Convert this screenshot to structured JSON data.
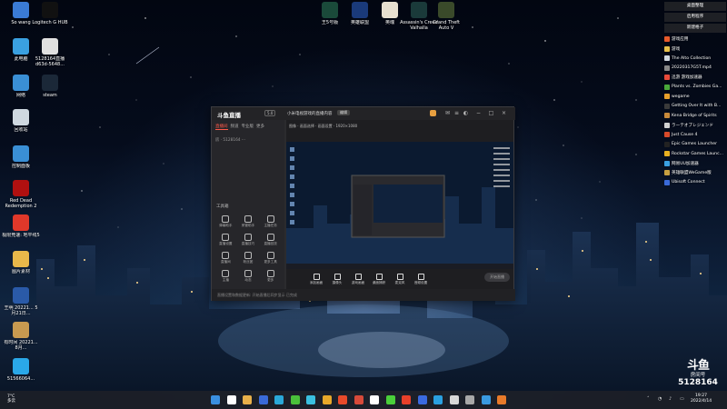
{
  "desktop": {
    "left_icons": [
      {
        "label": "So wang",
        "color": "#3a7bd5"
      },
      {
        "label": "Logitech G HUB",
        "color": "#111111"
      },
      {
        "label": "此电脑",
        "color": "#3aa0e0"
      },
      {
        "label": "5128164直播 d63d-5648...",
        "color": "#e0e0e0"
      },
      {
        "label": "网络",
        "color": "#3a8fd5"
      },
      {
        "label": "steam",
        "color": "#1b2838"
      },
      {
        "label": "回收站",
        "color": "#cfd8e0"
      },
      {
        "label": "控制面板",
        "color": "#3a8fd5"
      },
      {
        "label": "Red Dead Redemption 2",
        "color": "#b01010"
      },
      {
        "label": "极限竞速: 地平线5",
        "color": "#e0382a"
      },
      {
        "label": "图片素材",
        "color": "#e8b84a"
      },
      {
        "label": "王明 20221... 5月21日...",
        "color": "#2a5aa8"
      },
      {
        "label": "有时间 20221... 8月...",
        "color": "#c89a50"
      },
      {
        "label": "51566064...",
        "color": "#2aa8e8"
      }
    ],
    "top_icons": [
      {
        "label": "王5号版",
        "color": "#1a4a3a"
      },
      {
        "label": "英雄联盟",
        "color": "#1a3a7a"
      },
      {
        "label": "英魂",
        "color": "#e8e0d0"
      },
      {
        "label": "Assassin's Creed Valhalla",
        "color": "#1a3a3a"
      },
      {
        "label": "Grand Theft Auto V",
        "color": "#3a4a2a"
      }
    ],
    "right_list": {
      "header1": "桌面整理",
      "header2": "启用程序",
      "header3": "新建格子",
      "items": [
        {
          "label": "游戏应用",
          "color": "#e85a2a"
        },
        {
          "label": "游戏",
          "color": "#e8c04a"
        },
        {
          "label": "The Alto Collection",
          "color": "#d0d8e0"
        },
        {
          "label": "20220317G5T.mp4",
          "color": "#888888"
        },
        {
          "label": "迅游 游戏加速器",
          "color": "#e84a3a"
        },
        {
          "label": "Plants vs. Zombies Ga...",
          "color": "#4aa83a"
        },
        {
          "label": "wegame",
          "color": "#e8a02a"
        },
        {
          "label": "Getting Over It with B...",
          "color": "#3a3a3a"
        },
        {
          "label": "Kena Bridge of Spirits",
          "color": "#c88a3a"
        },
        {
          "label": "ラーテオブレジェンド",
          "color": "#d0d0d0"
        },
        {
          "label": "Just Cause 4",
          "color": "#d84a2a"
        },
        {
          "label": "Epic Games Launcher",
          "color": "#222222"
        },
        {
          "label": "Rockstar Games Launc...",
          "color": "#e8b020"
        },
        {
          "label": "网易UU加速器",
          "color": "#3aa0e0"
        },
        {
          "label": "英雄联盟WeGame版",
          "color": "#c8a040"
        },
        {
          "label": "Ubisoft Connect",
          "color": "#3a6ad8"
        }
      ]
    }
  },
  "app": {
    "logo": "斗鱼直播",
    "version": "5.0",
    "title": "小米电视游戏的直播内容",
    "title_button": "编辑",
    "tabs": [
      "直播间",
      "频道",
      "专业版",
      "更多"
    ],
    "room_line": "房 · 5128164 ···",
    "preview_head": "图像 · 画面选择 · 画面设置 · 1920×1080",
    "tools_title": "工具箱",
    "tools": [
      "弹幕助手",
      "房管助手",
      "主播任务",
      "直播设置",
      "直播技巧",
      "直播回放",
      "直播间",
      "粉丝团",
      "更多工具",
      "主播",
      "动态",
      "更多"
    ],
    "bottom_actions": [
      "添加画面",
      "摄像头",
      "游戏画面",
      "桌面捕获",
      "麦克风",
      "音频设置"
    ],
    "live_button": "开始直播",
    "status": "直播设置和数据更新: 开始直播后同步显示 已完成"
  },
  "taskbar": {
    "weather_temp": "7°C",
    "weather_desc": "多云",
    "time": "19:27",
    "date": "2022/4/14",
    "icon_colors": [
      "#3a8fe0",
      "#ffffff",
      "#e8b04a",
      "#3a6ad8",
      "#2aa8d8",
      "#4ac03a",
      "#3ac0e0",
      "#e8a82a",
      "#e84a2a",
      "#d84a3a",
      "#ffffff",
      "#4ad03a",
      "#e8402a",
      "#3a6ae0",
      "#2aa0e0",
      "#d8d8d8",
      "#a8a8a8",
      "#3a9ae0",
      "#e87a2a"
    ]
  },
  "watermark": {
    "logo": "斗鱼",
    "sub": "房间号",
    "room": "5128164"
  }
}
